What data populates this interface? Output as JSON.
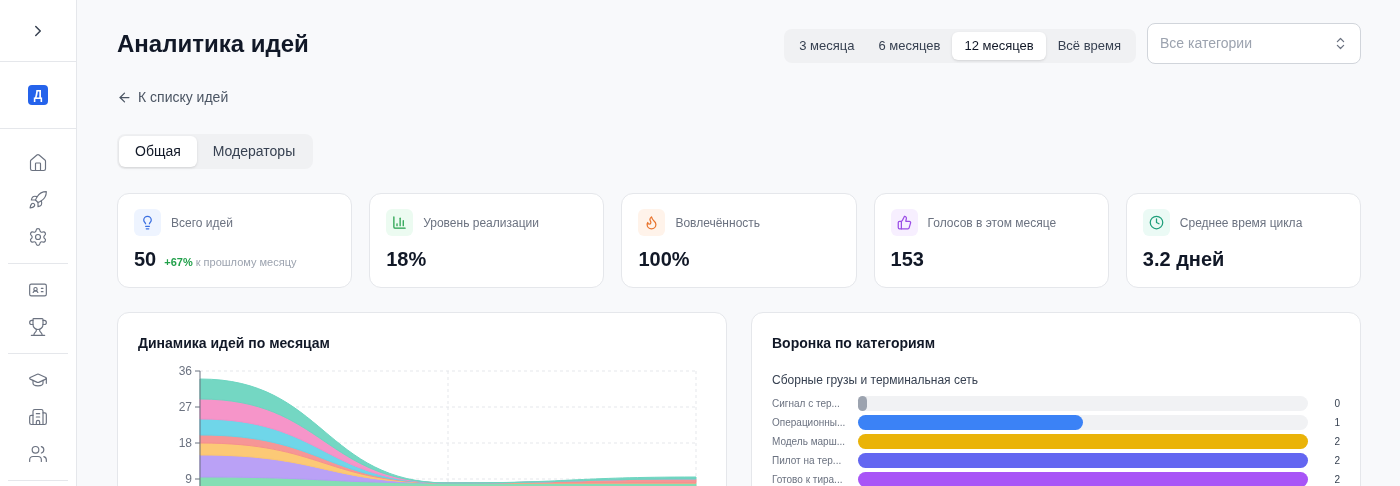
{
  "sidebar": {
    "avatar": "Д"
  },
  "header": {
    "title": "Аналитика идей",
    "periods": [
      {
        "label": "3 месяца",
        "selected": false
      },
      {
        "label": "6 месяцев",
        "selected": false
      },
      {
        "label": "12 месяцев",
        "selected": true
      },
      {
        "label": "Всё время",
        "selected": false
      }
    ],
    "category_select": {
      "placeholder": "Все категории"
    }
  },
  "back_link": "К списку идей",
  "tabs": [
    {
      "label": "Общая",
      "selected": true
    },
    {
      "label": "Модераторы",
      "selected": false
    }
  ],
  "stats": [
    {
      "kind": "ideas",
      "label": "Всего идей",
      "value": "50",
      "delta": "+67%",
      "delta_note": "к прошлому месяцу"
    },
    {
      "kind": "implementation",
      "label": "Уровень реализации",
      "value": "18%"
    },
    {
      "kind": "engagement",
      "label": "Вовлечённость",
      "value": "100%"
    },
    {
      "kind": "votes",
      "label": "Голосов в этом месяце",
      "value": "153"
    },
    {
      "kind": "cycle",
      "label": "Среднее время цикла",
      "value": "3.2 дней"
    }
  ],
  "dynamics": {
    "title": "Динамика идей по месяцам",
    "chart_data": {
      "type": "area",
      "stacked": true,
      "grid": true,
      "ylim": [
        0,
        36
      ],
      "yticks": [
        9,
        18,
        27,
        36
      ],
      "series": [
        {
          "color": "#7ddcb0",
          "values": [
            9.5,
            8,
            8
          ]
        },
        {
          "color": "#b69cf6",
          "values": [
            5.5,
            0,
            0
          ]
        },
        {
          "color": "#fcc66f",
          "values": [
            3,
            0,
            0
          ]
        },
        {
          "color": "#f59090",
          "values": [
            2,
            0,
            1
          ]
        },
        {
          "color": "#67d4e8",
          "values": [
            4,
            0,
            0
          ]
        },
        {
          "color": "#f58fc6",
          "values": [
            5,
            0,
            0
          ]
        },
        {
          "color": "#6dd5c0",
          "values": [
            5,
            0,
            0.5
          ]
        }
      ]
    }
  },
  "funnel": {
    "title": "Воронка по категориям",
    "category": "Сборные грузы и терминальная сеть",
    "rows": [
      {
        "label": "Сигнал с тер...",
        "level": 0,
        "value": "0",
        "color": "#9ca3af"
      },
      {
        "label": "Операционны...",
        "level": 0.5,
        "value": "1",
        "color": "#3b82f6"
      },
      {
        "label": "Модель марш...",
        "level": 1,
        "value": "2",
        "color": "#eab308"
      },
      {
        "label": "Пилот на тер...",
        "level": 1,
        "value": "2",
        "color": "#6366f1"
      },
      {
        "label": "Готово к тира...",
        "level": 1,
        "value": "2",
        "color": "#a855f7"
      }
    ]
  }
}
